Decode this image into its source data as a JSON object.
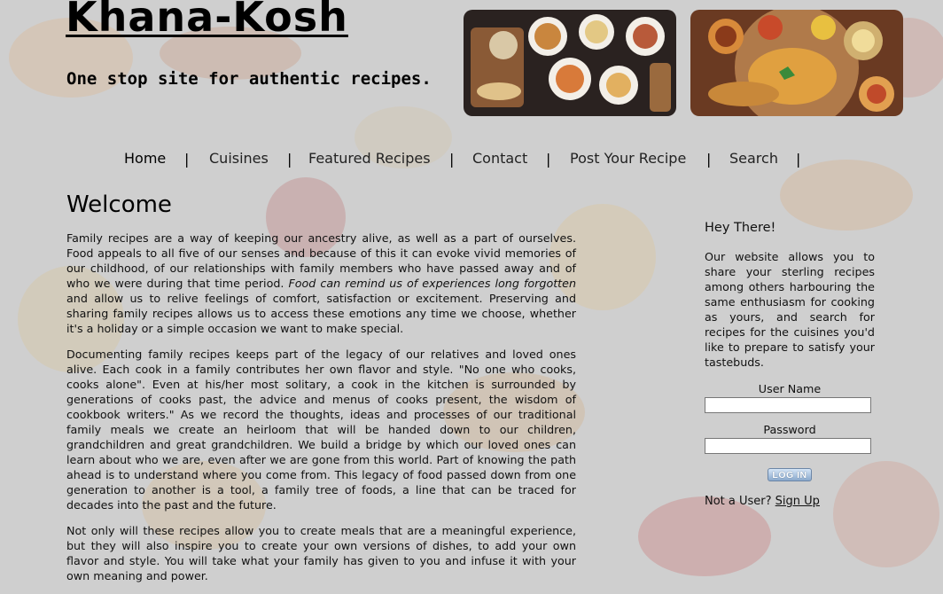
{
  "header": {
    "title": "Khana-Kosh",
    "tagline": "One stop site for authentic recipes."
  },
  "hero_images": [
    {
      "name": "italian-food-spread-photo"
    },
    {
      "name": "indian-thali-photo"
    }
  ],
  "nav": {
    "items": [
      {
        "label": "Home",
        "active": true
      },
      {
        "label": "Cuisines"
      },
      {
        "label": "Featured Recipes"
      },
      {
        "label": "Contact"
      },
      {
        "label": "Post Your Recipe"
      },
      {
        "label": "Search"
      }
    ],
    "separator": "|"
  },
  "main": {
    "heading": "Welcome",
    "p1_a": "Family recipes are a way of keeping our ancestry alive, as well as a part of ourselves. Food appeals to all five of our senses and because of this it can evoke vivid memories of our childhood, of our relationships with family members who have passed away and of who we were during that time period. ",
    "p1_em": "Food can remind us of experiences long forgotten",
    "p1_b": " and allow us to relive feelings of comfort, satisfaction or excitement. Preserving and sharing family recipes allows us to access these emotions any time we choose, whether it's a holiday or a simple occasion we want to make special.",
    "p2": "Documenting family recipes keeps part of the legacy of our relatives and loved ones alive. Each cook in a family contributes her own flavor and style. \"No one who cooks, cooks alone\". Even at his/her most solitary, a cook in the kitchen is surrounded by generations of cooks past, the advice and menus of cooks present, the wisdom of cookbook writers.\" As we record the thoughts, ideas and processes of our traditional family meals we create an heirloom that will be handed down to our children, grandchildren and great grandchildren. We build a bridge by which our loved ones can learn about who we are, even after we are gone from this world. Part of knowing the path ahead is to understand where you come from. This legacy of food passed down from one generation to another is a tool, a family tree of foods, a line that can be traced for decades into the past and the future.",
    "p3": "Not only will these recipes allow you to create meals that are a meaningful experience, but they will also inspire you to create your own versions of dishes, to add your own flavor and style. You will take what your family has given to you and infuse it with your own meaning and power."
  },
  "sidebar": {
    "heading": "Hey There!",
    "intro": "Our website allows you to share your sterling recipes among others harbouring the same enthusiasm for cooking as yours, and search for recipes for the cuisines you'd like to prepare to satisfy your tastebuds.",
    "username_label": "User Name",
    "username_value": "",
    "password_label": "Password",
    "password_value": "",
    "login_label": "LOG IN",
    "signup_prompt": "Not a User? ",
    "signup_link": "Sign Up"
  }
}
